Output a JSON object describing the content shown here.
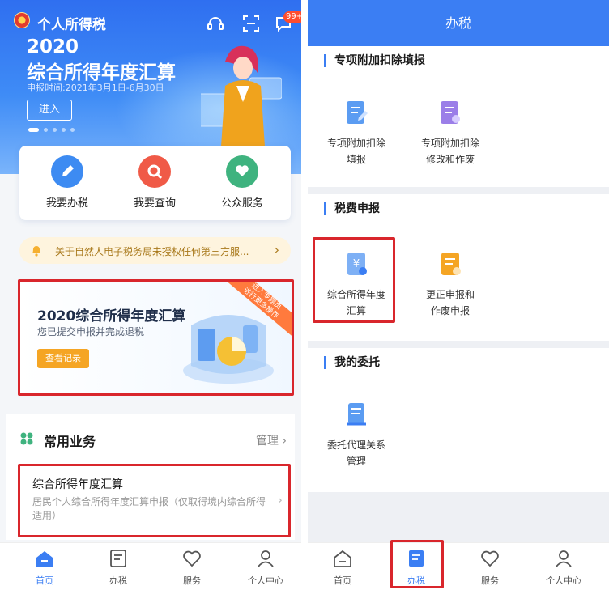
{
  "left": {
    "app_title": "个人所得税",
    "badge": "99+",
    "banner": {
      "year": "2020",
      "title": "综合所得年度汇算",
      "date": "申报时间:2021年3月1日-6月30日",
      "enter": "进入"
    },
    "quick": [
      {
        "label": "我要办税",
        "color": "#3d8bf2",
        "icon": "pen-icon"
      },
      {
        "label": "我要查询",
        "color": "#f05a47",
        "icon": "search-icon"
      },
      {
        "label": "公众服务",
        "color": "#3fb37f",
        "icon": "heart-hand-icon"
      }
    ],
    "notice": "关于自然人电子税务局未授权任何第三方服...",
    "promo": {
      "title": "2020综合所得年度汇算",
      "subtitle": "您已提交申报并完成退税",
      "button": "查看记录",
      "ribbon_line1": "进入专题页",
      "ribbon_line2": "进行更多操作"
    },
    "common": {
      "title": "常用业务",
      "manage": "管理",
      "item_title": "综合所得年度汇算",
      "item_desc": "居民个人综合所得年度汇算申报（仅取得境内综合所得适用）"
    },
    "tabs": [
      "首页",
      "办税",
      "服务",
      "个人中心"
    ]
  },
  "right": {
    "header": "办税",
    "sections": [
      {
        "title": "专项附加扣除填报",
        "items": [
          "专项附加扣除\n填报",
          "专项附加扣除\n修改和作废"
        ]
      },
      {
        "title": "税费申报",
        "items": [
          "综合所得年度\n汇算",
          "更正申报和\n作废申报"
        ]
      },
      {
        "title": "我的委托",
        "items": [
          "委托代理关系\n管理"
        ]
      }
    ],
    "tabs": [
      "首页",
      "办税",
      "服务",
      "个人中心"
    ]
  },
  "colors": {
    "brand_blue": "#3b7ef3",
    "highlight_red": "#d9262c",
    "orange": "#f5a524"
  }
}
